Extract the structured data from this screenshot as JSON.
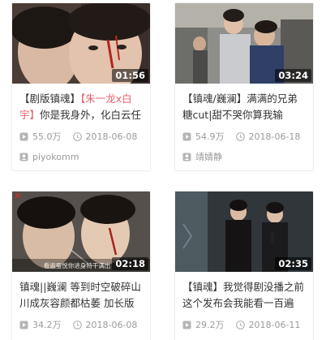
{
  "cards": [
    {
      "duration": "01:56",
      "title_parts": [
        "【剧版镇魂】",
        "【朱一龙x白宇】",
        "你是我身外，化白云任"
      ],
      "views": "55.0万",
      "date": "2018-06-08",
      "author": "piyokomm"
    },
    {
      "duration": "03:24",
      "title": "【镇魂/巍澜】满满的兄弟糖cut|甜不哭你算我输",
      "views": "54.9万",
      "date": "2018-06-18",
      "author": "靖婧静"
    },
    {
      "duration": "02:18",
      "title": "镇魂||巍澜 等到时空破碎山川成灰容颜都枯萎 加长版时",
      "views": "34.2万",
      "date": "2018-06-08",
      "thumb_caption": "看遍蚕悦你进身特干满出"
    },
    {
      "duration": "02:35",
      "title": "【镇魂】我觉得剧没播之前这个发布会我能看一百遍 现",
      "views": "29.2万",
      "date": "2018-06-11"
    }
  ],
  "icons": {
    "views": "play-icon",
    "date": "clock-icon",
    "author": "user-icon"
  },
  "colors": {
    "highlight": "#e8636f",
    "meta": "#9a9a9a",
    "title": "#333333"
  }
}
